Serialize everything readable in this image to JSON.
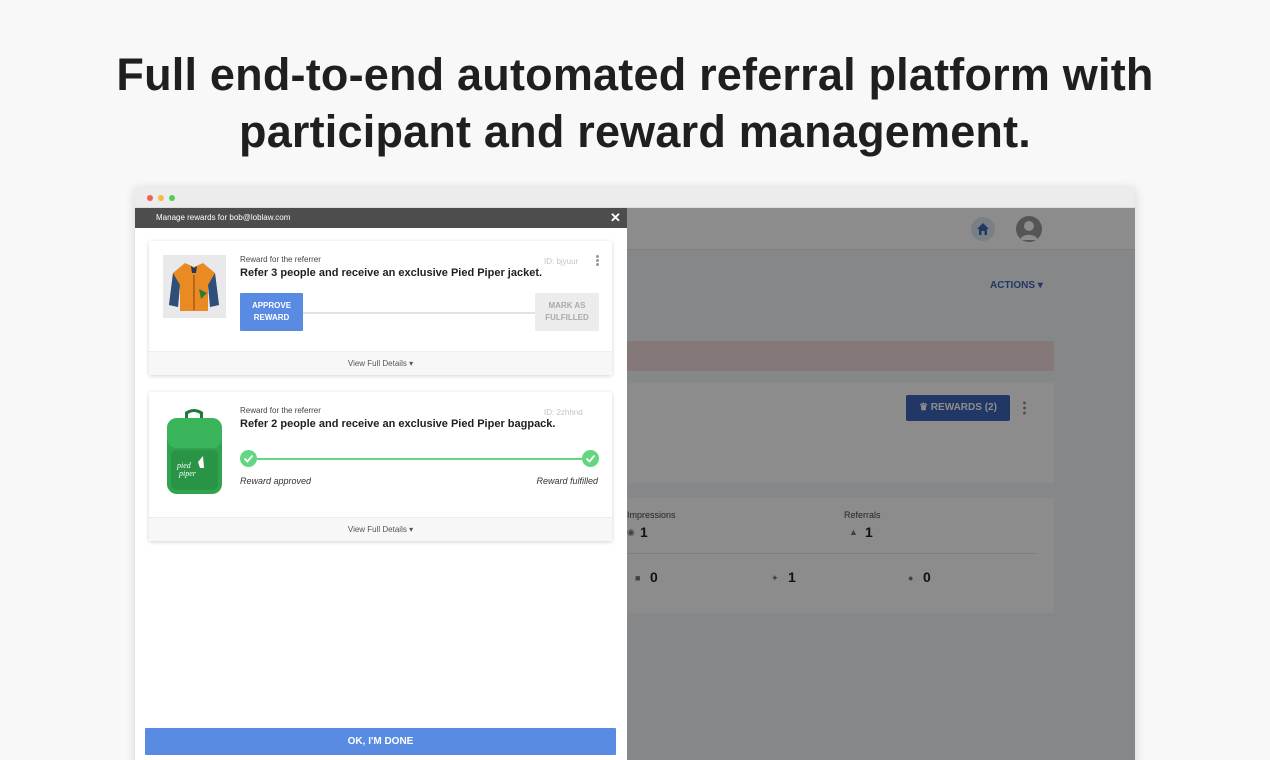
{
  "headline": {
    "line1": "Full end-to-end automated referral platform with",
    "line2": "participant and reward management."
  },
  "background_app": {
    "actions_label": "ACTIONS ▾",
    "rewards_button": "♛ REWARDS (2)",
    "stats": {
      "impressions_label": "Impressions",
      "impressions_value": "1",
      "referrals_label": "Referrals",
      "referrals_value": "1",
      "facebook_value": "0",
      "twitter_value": "1",
      "pinterest_value": "0"
    }
  },
  "modal": {
    "title": "Manage rewards for bob@loblaw.com",
    "close_glyph": "✕",
    "rewards": [
      {
        "kicker": "Reward for the referrer",
        "id": "ID: bjyuur",
        "title": "Refer 3 people and receive an exclusive Pied Piper jacket.",
        "approve_label": "APPROVE REWARD",
        "mark_label": "MARK AS FULFILLED",
        "footer": "View Full Details ▾"
      },
      {
        "kicker": "Reward for the referrer",
        "id": "ID: 2zhhnd",
        "title": "Refer 2 people and receive an exclusive Pied Piper bagpack.",
        "status_left": "Reward approved",
        "status_right": "Reward fulfilled",
        "footer": "View Full Details ▾"
      }
    ],
    "done_label": "OK, I'M DONE"
  },
  "colors": {
    "primary": "#5a8be2",
    "success": "#62d680",
    "header": "#4d4d4d"
  }
}
